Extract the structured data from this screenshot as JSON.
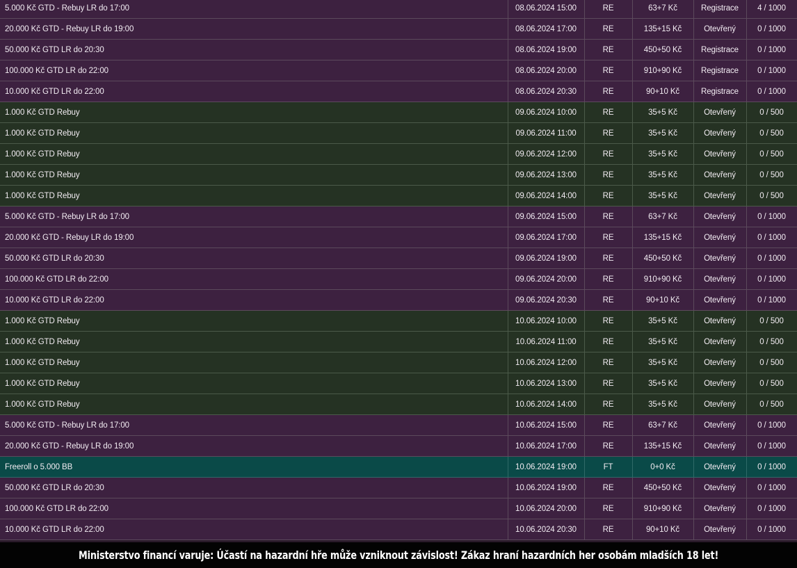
{
  "tournaments": [
    {
      "name": "5.000 Kč GTD - Rebuy LR do 17:00",
      "datetime": "08.06.2024 15:00",
      "type": "RE",
      "buyin": "63+7 Kč",
      "status": "Registrace",
      "players": "4 / 1000",
      "row_style": "re"
    },
    {
      "name": "20.000 Kč GTD - Rebuy LR do 19:00",
      "datetime": "08.06.2024 17:00",
      "type": "RE",
      "buyin": "135+15 Kč",
      "status": "Otevřený",
      "players": "0 / 1000",
      "row_style": "re"
    },
    {
      "name": "50.000 Kč GTD LR do 20:30",
      "datetime": "08.06.2024 19:00",
      "type": "RE",
      "buyin": "450+50 Kč",
      "status": "Registrace",
      "players": "0 / 1000",
      "row_style": "re"
    },
    {
      "name": "100.000 Kč GTD LR do 22:00",
      "datetime": "08.06.2024 20:00",
      "type": "RE",
      "buyin": "910+90 Kč",
      "status": "Registrace",
      "players": "0 / 1000",
      "row_style": "re"
    },
    {
      "name": "10.000 Kč GTD LR do 22:00",
      "datetime": "08.06.2024 20:30",
      "type": "RE",
      "buyin": "90+10 Kč",
      "status": "Registrace",
      "players": "0 / 1000",
      "row_style": "re"
    },
    {
      "name": "1.000 Kč GTD Rebuy",
      "datetime": "09.06.2024 10:00",
      "type": "RE",
      "buyin": "35+5 Kč",
      "status": "Otevřený",
      "players": "0 / 500",
      "row_style": "green"
    },
    {
      "name": "1.000 Kč GTD Rebuy",
      "datetime": "09.06.2024 11:00",
      "type": "RE",
      "buyin": "35+5 Kč",
      "status": "Otevřený",
      "players": "0 / 500",
      "row_style": "green"
    },
    {
      "name": "1.000 Kč GTD Rebuy",
      "datetime": "09.06.2024 12:00",
      "type": "RE",
      "buyin": "35+5 Kč",
      "status": "Otevřený",
      "players": "0 / 500",
      "row_style": "green"
    },
    {
      "name": "1.000 Kč GTD Rebuy",
      "datetime": "09.06.2024 13:00",
      "type": "RE",
      "buyin": "35+5 Kč",
      "status": "Otevřený",
      "players": "0 / 500",
      "row_style": "green"
    },
    {
      "name": "1.000 Kč GTD Rebuy",
      "datetime": "09.06.2024 14:00",
      "type": "RE",
      "buyin": "35+5 Kč",
      "status": "Otevřený",
      "players": "0 / 500",
      "row_style": "green"
    },
    {
      "name": "5.000 Kč GTD - Rebuy LR do 17:00",
      "datetime": "09.06.2024 15:00",
      "type": "RE",
      "buyin": "63+7 Kč",
      "status": "Otevřený",
      "players": "0 / 1000",
      "row_style": "re"
    },
    {
      "name": "20.000 Kč GTD - Rebuy LR do 19:00",
      "datetime": "09.06.2024 17:00",
      "type": "RE",
      "buyin": "135+15 Kč",
      "status": "Otevřený",
      "players": "0 / 1000",
      "row_style": "re"
    },
    {
      "name": "50.000 Kč GTD LR do 20:30",
      "datetime": "09.06.2024 19:00",
      "type": "RE",
      "buyin": "450+50 Kč",
      "status": "Otevřený",
      "players": "0 / 1000",
      "row_style": "re"
    },
    {
      "name": "100.000 Kč GTD LR do 22:00",
      "datetime": "09.06.2024 20:00",
      "type": "RE",
      "buyin": "910+90 Kč",
      "status": "Otevřený",
      "players": "0 / 1000",
      "row_style": "re"
    },
    {
      "name": "10.000 Kč GTD LR do 22:00",
      "datetime": "09.06.2024 20:30",
      "type": "RE",
      "buyin": "90+10 Kč",
      "status": "Otevřený",
      "players": "0 / 1000",
      "row_style": "re"
    },
    {
      "name": "1.000 Kč GTD Rebuy",
      "datetime": "10.06.2024 10:00",
      "type": "RE",
      "buyin": "35+5 Kč",
      "status": "Otevřený",
      "players": "0 / 500",
      "row_style": "green"
    },
    {
      "name": "1.000 Kč GTD Rebuy",
      "datetime": "10.06.2024 11:00",
      "type": "RE",
      "buyin": "35+5 Kč",
      "status": "Otevřený",
      "players": "0 / 500",
      "row_style": "green"
    },
    {
      "name": "1.000 Kč GTD Rebuy",
      "datetime": "10.06.2024 12:00",
      "type": "RE",
      "buyin": "35+5 Kč",
      "status": "Otevřený",
      "players": "0 / 500",
      "row_style": "green"
    },
    {
      "name": "1.000 Kč GTD Rebuy",
      "datetime": "10.06.2024 13:00",
      "type": "RE",
      "buyin": "35+5 Kč",
      "status": "Otevřený",
      "players": "0 / 500",
      "row_style": "green"
    },
    {
      "name": "1.000 Kč GTD Rebuy",
      "datetime": "10.06.2024 14:00",
      "type": "RE",
      "buyin": "35+5 Kč",
      "status": "Otevřený",
      "players": "0 / 500",
      "row_style": "green"
    },
    {
      "name": "5.000 Kč GTD - Rebuy LR do 17:00",
      "datetime": "10.06.2024 15:00",
      "type": "RE",
      "buyin": "63+7 Kč",
      "status": "Otevřený",
      "players": "0 / 1000",
      "row_style": "re"
    },
    {
      "name": "20.000 Kč GTD - Rebuy LR do 19:00",
      "datetime": "10.06.2024 17:00",
      "type": "RE",
      "buyin": "135+15 Kč",
      "status": "Otevřený",
      "players": "0 / 1000",
      "row_style": "re"
    },
    {
      "name": "Freeroll o 5.000 BB",
      "datetime": "10.06.2024 19:00",
      "type": "FT",
      "buyin": "0+0 Kč",
      "status": "Otevřený",
      "players": "0 / 1000",
      "row_style": "ft"
    },
    {
      "name": "50.000 Kč GTD LR do 20:30",
      "datetime": "10.06.2024 19:00",
      "type": "RE",
      "buyin": "450+50 Kč",
      "status": "Otevřený",
      "players": "0 / 1000",
      "row_style": "re"
    },
    {
      "name": "100.000 Kč GTD LR do 22:00",
      "datetime": "10.06.2024 20:00",
      "type": "RE",
      "buyin": "910+90 Kč",
      "status": "Otevřený",
      "players": "0 / 1000",
      "row_style": "re"
    },
    {
      "name": "10.000 Kč GTD LR do 22:00",
      "datetime": "10.06.2024 20:30",
      "type": "RE",
      "buyin": "90+10 Kč",
      "status": "Otevřený",
      "players": "0 / 1000",
      "row_style": "re"
    }
  ],
  "colors": {
    "re_row": "#3d2140",
    "green_row": "#253223",
    "ft_row": "#0a4a48",
    "warning_bg": "#030303"
  },
  "warning": {
    "text": "Ministerstvo financí varuje: Účastí na hazardní hře může vzniknout závislost! Zákaz hraní hazardních her osobám mladších 18 let!"
  }
}
